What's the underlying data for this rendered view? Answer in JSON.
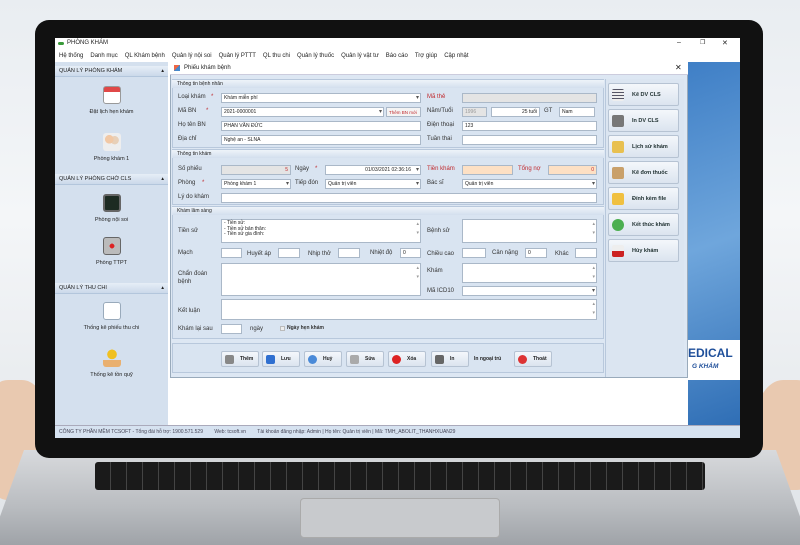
{
  "app": {
    "title": "PHÒNG KHÁM",
    "window_controls": [
      "–",
      "❐",
      "✕"
    ]
  },
  "menu": [
    "Hệ thống",
    "Danh mục",
    "QL Khám bệnh",
    "Quản lý nội soi",
    "Quản lý PTTT",
    "QL thu chi",
    "Quản lý thuốc",
    "Quản lý vật tư",
    "Báo cáo",
    "Trợ giúp",
    "Cập nhật"
  ],
  "sidebar": {
    "groups": [
      {
        "title": "QUẢN LÝ PHÒNG KHÁM",
        "items": [
          "Đặt lịch hẹn khám",
          "Phòng khám 1"
        ]
      },
      {
        "title": "QUẢN LÝ PHÒNG CHỜ CLS",
        "items": [
          "Phòng nội soi",
          "Phòng TTPT"
        ]
      },
      {
        "title": "QUẢN LÝ THU CHI",
        "items": [
          "Thống kê phiếu thu chi",
          "Thống kê tồn quỹ"
        ]
      }
    ]
  },
  "dialog": {
    "title": "Phiếu khám bệnh",
    "patient": {
      "section": "Thông tin bệnh nhân",
      "loai_kham_label": "Loại khám",
      "loai_kham": "Khám miễn phí",
      "ma_bn_label": "Mã BN",
      "ma_bn": "2021-0000001",
      "them_bn_moi": "Thêm BN mới",
      "ho_ten_label": "Họ tên BN",
      "ho_ten": "PHAN VĂN ĐỨC",
      "dia_chi_label": "Địa chỉ",
      "dia_chi": "Nghệ an - SLNA",
      "ma_the_label": "Mã thẻ",
      "ma_the": "",
      "nam_tuoi_label": "Năm/Tuổi",
      "nam_sinh": "1996",
      "tuoi": "25 tuổi",
      "gt_label": "GT",
      "gioi_tinh": "Nam",
      "dien_thoai_label": "Điện thoại",
      "dien_thoai": "123",
      "tuan_thai_label": "Tuần thai",
      "tuan_thai": ""
    },
    "exam": {
      "section": "Thông tin khám",
      "so_phieu_label": "Số phiếu",
      "so_phieu": "5",
      "ngay_label": "Ngày",
      "ngay": "01/03/2021 02:36:16",
      "tien_kham_label": "Tiền khám",
      "tien_kham": "",
      "tong_no_label": "Tổng nợ",
      "tong_no": "0",
      "phong_label": "Phòng",
      "phong": "Phòng khám 1",
      "tiep_don_label": "Tiếp đón",
      "tiep_don": "Quản trị viên",
      "bac_si_label": "Bác sĩ",
      "bac_si": "Quản trị viên",
      "ly_do_label": "Lý do khám",
      "ly_do": ""
    },
    "clinical": {
      "section": "Khám lâm sàng",
      "tien_su_label": "Tiền sử",
      "tien_su": "- Tiền sử:\n- Tiền sử bản thân:\n- Tiền sử gia đình:",
      "benh_su_label": "Bệnh sử",
      "mach_label": "Mạch",
      "huyet_ap_label": "Huyết áp",
      "nhip_tho_label": "Nhịp thở",
      "nhiet_do_label": "Nhiệt độ",
      "nhiet_do": "0",
      "chieu_cao_label": "Chiều cao",
      "can_nang_label": "Cân nặng",
      "can_nang": "0",
      "khac_label": "Khác",
      "chan_doan_label": "Chẩn đoán bệnh",
      "kham_label": "Khám",
      "icd_label": "Mã ICD10",
      "ket_luan_label": "Kết luận",
      "kham_lai_label": "Khám lại sau",
      "ngay_unit": "ngày",
      "hen_kham_label": "Ngày hẹn khám"
    },
    "buttons": [
      "Thêm",
      "Lưu",
      "Huỷ",
      "Sửa",
      "Xóa",
      "In",
      "In ngoại trú",
      "Thoát"
    ],
    "side_buttons": [
      "Kê DV CLS",
      "In DV CLS",
      "Lịch sử khám",
      "Kê đơn thuốc",
      "Đính kèm file",
      "Kết thúc khám",
      "Hủy khám"
    ]
  },
  "background_brand": {
    "line1": "EDICAL",
    "line2": "G KHÁM"
  },
  "status": [
    "CÔNG TY PHẦN MỀM TCSOFT - Tổng đài hỗ trợ: 1900.571.529",
    "Web: tcsoft.vn",
    "Tài khoản đăng nhập: Admin | Họ tên: Quản trị viên | Mã: TMH_ABOLIT_THANHXUAN29"
  ],
  "colors": {
    "accent": "#3f7fc6",
    "required": "#c0282c",
    "sidebar": "#d4e0ee"
  }
}
